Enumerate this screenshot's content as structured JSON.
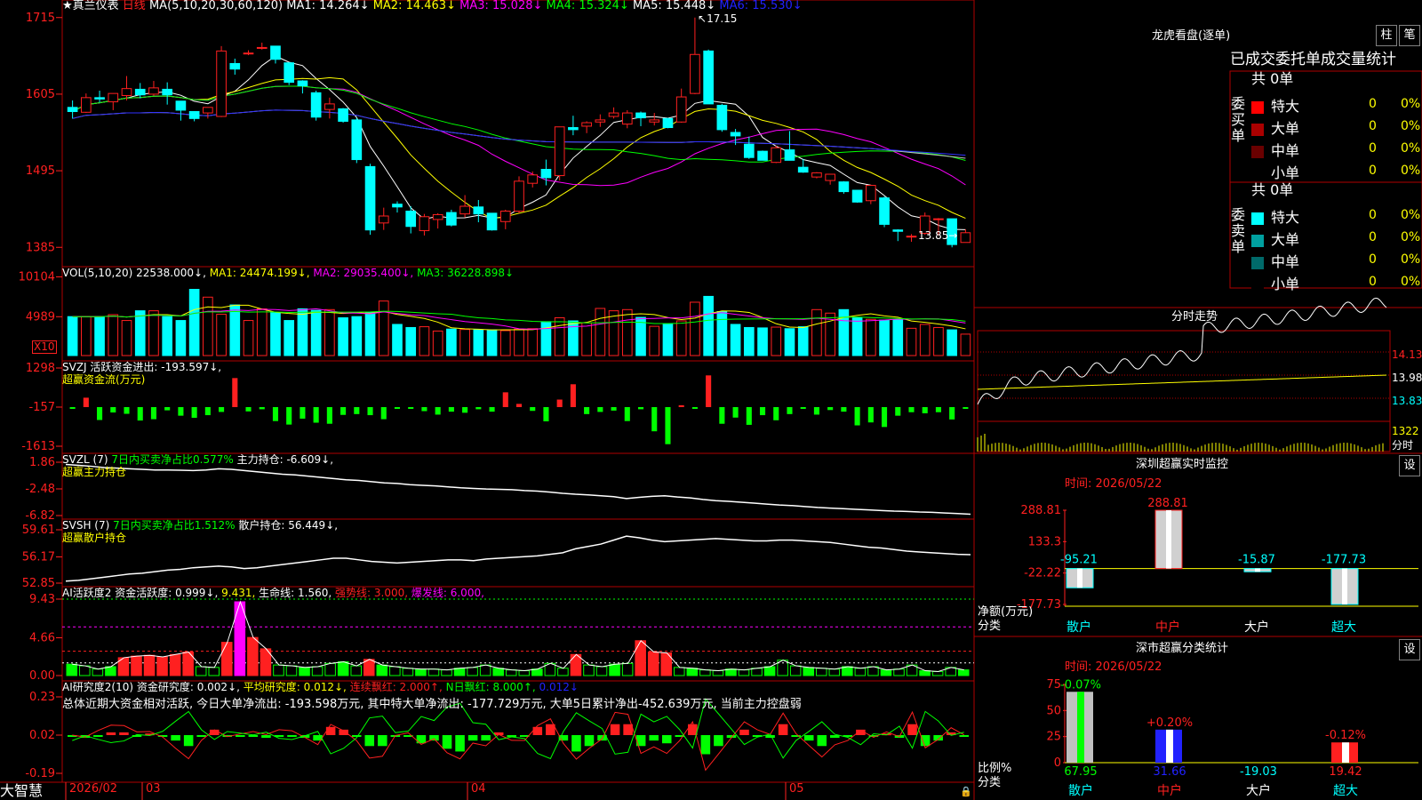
{
  "stock": {
    "title": "★真兰仪表",
    "period": "日线",
    "ma_title": "MA(5,10,20,30,60,120)",
    "ma_values": [
      "MA1: 14.264↓",
      "MA2: 14.463↓",
      "MA3: 15.028↓",
      "MA4: 15.324↓",
      "MA5: 15.448↓",
      "MA6: 15.530↓"
    ],
    "ma_colors": [
      "#ffffff",
      "#ffff00",
      "#ff00ff",
      "#00ff00",
      "#c0c0c0",
      "#3030ff"
    ],
    "max_label": "17.15",
    "min_label": "13.85",
    "y_ticks": [
      "1715",
      "1605",
      "1495",
      "1385"
    ],
    "x_labels": [
      "2026/02",
      "03",
      "04",
      "05"
    ],
    "x_marks": [
      "2026/02",
      "03",
      "04",
      "05"
    ]
  },
  "candles": {
    "type": "candlestick",
    "ylim": [
      13.7,
      17.3
    ],
    "data": [
      [
        15.86,
        15.96,
        15.7,
        15.8
      ],
      [
        15.79,
        16.06,
        15.78,
        16.0
      ],
      [
        16.0,
        16.1,
        15.93,
        15.98
      ],
      [
        15.94,
        16.04,
        15.82,
        16.06
      ],
      [
        16.03,
        16.31,
        15.96,
        16.13
      ],
      [
        16.12,
        16.21,
        15.99,
        16.04
      ],
      [
        16.05,
        16.24,
        16.03,
        16.14
      ],
      [
        16.12,
        16.22,
        15.9,
        16.04
      ],
      [
        15.95,
        15.95,
        15.67,
        15.82
      ],
      [
        15.8,
        15.8,
        15.66,
        15.7
      ],
      [
        15.78,
        15.85,
        15.7,
        15.86
      ],
      [
        15.73,
        16.74,
        15.72,
        16.67
      ],
      [
        16.49,
        16.56,
        16.33,
        16.41
      ],
      [
        16.64,
        16.68,
        16.61,
        16.64
      ],
      [
        16.71,
        16.79,
        16.69,
        16.72
      ],
      [
        16.74,
        16.74,
        16.49,
        16.55
      ],
      [
        16.5,
        16.5,
        16.18,
        16.22
      ],
      [
        16.24,
        16.25,
        16.06,
        16.17
      ],
      [
        16.07,
        16.1,
        15.67,
        15.72
      ],
      [
        15.83,
        16.0,
        15.7,
        15.91
      ],
      [
        15.84,
        15.85,
        15.64,
        15.66
      ],
      [
        15.68,
        15.71,
        15.06,
        15.11
      ],
      [
        15.01,
        15.05,
        14.03,
        14.1
      ],
      [
        14.2,
        14.42,
        14.1,
        14.3
      ],
      [
        14.47,
        14.51,
        14.35,
        14.43
      ],
      [
        14.37,
        14.44,
        14.05,
        14.15
      ],
      [
        14.09,
        14.33,
        14.02,
        14.29
      ],
      [
        14.25,
        14.34,
        14.12,
        14.32
      ],
      [
        14.35,
        14.39,
        14.15,
        14.17
      ],
      [
        14.33,
        14.6,
        14.28,
        14.44
      ],
      [
        14.43,
        14.53,
        14.21,
        14.33
      ],
      [
        14.34,
        14.34,
        14.09,
        14.1
      ],
      [
        14.22,
        14.39,
        14.11,
        14.37
      ],
      [
        14.37,
        14.87,
        14.34,
        14.8
      ],
      [
        14.77,
        14.94,
        14.71,
        14.89
      ],
      [
        14.97,
        15.11,
        14.74,
        14.85
      ],
      [
        14.88,
        15.58,
        14.81,
        15.58
      ],
      [
        15.57,
        15.74,
        15.46,
        15.54
      ],
      [
        15.59,
        15.66,
        15.49,
        15.64
      ],
      [
        15.65,
        15.76,
        15.58,
        15.68
      ],
      [
        15.73,
        15.86,
        15.7,
        15.78
      ],
      [
        15.62,
        15.82,
        15.56,
        15.78
      ],
      [
        15.78,
        15.8,
        15.59,
        15.71
      ],
      [
        15.65,
        15.78,
        15.6,
        15.68
      ],
      [
        15.7,
        15.71,
        15.56,
        15.57
      ],
      [
        15.65,
        16.13,
        15.64,
        16.01
      ],
      [
        16.06,
        17.15,
        16.05,
        16.62
      ],
      [
        16.67,
        16.69,
        15.92,
        15.91
      ],
      [
        15.89,
        15.91,
        15.51,
        15.54
      ],
      [
        15.5,
        15.55,
        15.32,
        15.45
      ],
      [
        15.33,
        15.44,
        15.12,
        15.14
      ],
      [
        15.23,
        15.24,
        15.1,
        15.1
      ],
      [
        15.07,
        15.31,
        15.06,
        15.28
      ],
      [
        15.25,
        15.52,
        15.15,
        15.1
      ],
      [
        15.0,
        15.12,
        14.92,
        14.93
      ],
      [
        14.86,
        14.93,
        14.84,
        14.92
      ],
      [
        14.81,
        14.89,
        14.75,
        14.9
      ],
      [
        14.79,
        14.8,
        14.62,
        14.65
      ],
      [
        14.67,
        14.67,
        14.49,
        14.5
      ],
      [
        14.52,
        14.75,
        14.47,
        14.74
      ],
      [
        14.56,
        14.58,
        14.14,
        14.18
      ],
      [
        14.1,
        14.11,
        13.94,
        14.08
      ],
      [
        14.0,
        14.04,
        13.93,
        14.01
      ],
      [
        14.05,
        14.35,
        14.03,
        14.3
      ],
      [
        14.25,
        14.27,
        14.02,
        14.26
      ],
      [
        14.26,
        14.26,
        13.85,
        13.89
      ],
      [
        13.92,
        14.11,
        13.92,
        14.06
      ]
    ]
  },
  "volume": {
    "title": "VOL(5,10,20)",
    "val_main": "22538.000↓",
    "ma1": "MA1: 24474.199↓",
    "ma2": "MA2: 29035.400↓",
    "ma3": "MA3: 36228.898↓",
    "y_ticks": [
      "10104",
      "4989"
    ],
    "unit_box": "X10",
    "values": [
      10000,
      10000,
      10000,
      10500,
      9000,
      11500,
      11500,
      10000,
      9000,
      17000,
      15000,
      10600,
      13000,
      9000,
      12000,
      11000,
      9000,
      12000,
      11600,
      11800,
      9700,
      10000,
      11100,
      14000,
      8000,
      7200,
      7400,
      6300,
      6800,
      6700,
      6600,
      6600,
      6400,
      6800,
      6900,
      8700,
      9700,
      8900,
      8400,
      12100,
      11500,
      11800,
      9800,
      7500,
      8200,
      8900,
      13700,
      15200,
      11300,
      8000,
      7200,
      7100,
      7300,
      6900,
      7400,
      11800,
      10900,
      11800,
      9800,
      9300,
      9100,
      9200,
      7000,
      8000,
      7200,
      6600,
      5500
    ],
    "ylim": [
      0,
      21000
    ]
  },
  "svzj": {
    "title": "SVZJ",
    "label": "活跃资金进出: -193.597↓,",
    "sub": "超赢资金流(万元)",
    "y_ticks": [
      "1298",
      "-157",
      "-1613"
    ],
    "ylim": [
      -1613,
      1298
    ],
    "values": [
      -30,
      350,
      -480,
      -200,
      -250,
      -500,
      -450,
      -120,
      -320,
      -400,
      -300,
      -180,
      1080,
      -160,
      -80,
      -520,
      -650,
      -430,
      -580,
      -620,
      -290,
      -260,
      -300,
      -450,
      -60,
      -40,
      -150,
      -280,
      -170,
      -210,
      -80,
      -170,
      550,
      120,
      -140,
      -530,
      280,
      850,
      -260,
      -180,
      -130,
      -520,
      -80,
      -900,
      -1380,
      70,
      -60,
      1180,
      -620,
      -390,
      -660,
      -300,
      -490,
      -260,
      -60,
      -280,
      -110,
      -170,
      -680,
      -570,
      -740,
      -320,
      -190,
      -230,
      -190,
      -460,
      -50,
      350,
      -400,
      -150,
      -100,
      -80
    ]
  },
  "svzl": {
    "title": "SVZL (7)",
    "label1": "7日内买卖净占比0.577%",
    "label2": "主力持仓: -6.609↓,",
    "sub": "超赢主力持仓",
    "y_ticks": [
      "1.86",
      "-2.48",
      "-6.82"
    ],
    "ylim": [
      -6.82,
      1.86
    ],
    "values": [
      1.5,
      1.35,
      1.2,
      1.0,
      0.9,
      0.8,
      0.7,
      0.6,
      0.6,
      0.55,
      0.5,
      0.6,
      0.8,
      0.7,
      0.5,
      0.3,
      0.1,
      -0.1,
      -0.2,
      -0.4,
      -0.6,
      -0.8,
      -1.0,
      -1.1,
      -1.3,
      -1.5,
      -1.6,
      -1.8,
      -1.9,
      -2.0,
      -2.15,
      -2.3,
      -2.4,
      -2.5,
      -2.55,
      -2.6,
      -2.75,
      -2.85,
      -3.0,
      -3.2,
      -3.35,
      -3.45,
      -3.6,
      -3.75,
      -4.05,
      -3.85,
      -3.7,
      -3.6,
      -3.8,
      -3.95,
      -4.2,
      -4.4,
      -4.5,
      -4.65,
      -4.8,
      -4.95,
      -5.1,
      -5.2,
      -5.35,
      -5.5,
      -5.6,
      -5.7,
      -5.8,
      -5.9,
      -6.0,
      -6.1,
      -6.15,
      -6.25,
      -6.3,
      -6.4,
      -6.5,
      -6.61
    ]
  },
  "svsh": {
    "title": "SVSH (7)",
    "label1": "7日内买卖净占比1.512%",
    "label2": "散户持仓: 56.449↓,",
    "sub": "超赢散户持仓",
    "y_ticks": [
      "59.61",
      "56.17",
      "52.85"
    ],
    "ylim": [
      52.85,
      59.61
    ],
    "values": [
      53.1,
      53.2,
      53.4,
      53.6,
      53.8,
      54.0,
      54.1,
      54.3,
      54.5,
      54.6,
      54.8,
      54.9,
      55.0,
      54.9,
      54.7,
      54.8,
      55.0,
      55.2,
      55.4,
      55.6,
      55.8,
      56.0,
      56.0,
      55.8,
      55.6,
      55.5,
      55.4,
      55.5,
      55.6,
      55.7,
      55.8,
      55.8,
      55.7,
      55.9,
      56.0,
      56.1,
      56.2,
      56.3,
      56.5,
      56.7,
      57.2,
      57.5,
      57.8,
      58.3,
      58.8,
      58.6,
      58.3,
      58.1,
      58.2,
      58.3,
      58.4,
      58.5,
      58.4,
      58.3,
      58.2,
      58.2,
      58.3,
      58.3,
      58.2,
      58.1,
      58.0,
      57.8,
      57.6,
      57.4,
      57.3,
      57.1,
      56.9,
      56.8,
      56.7,
      56.6,
      56.5,
      56.45
    ]
  },
  "ai1": {
    "title": "AI活跃度2",
    "label1": "资金活跃度: 0.999↓",
    "label2": "9.431,",
    "label3": "生命线: 1.560,",
    "label4": "强势线: 3.000,",
    "label5": "爆发线: 6.000,",
    "y_ticks": [
      "9.43",
      "4.66",
      "0.00"
    ],
    "ylim": [
      0,
      9.43
    ],
    "values": [
      1.4,
      1.2,
      0.8,
      1.1,
      2.2,
      2.4,
      2.5,
      2.3,
      2.6,
      2.9,
      1.1,
      1.0,
      4.1,
      9.1,
      4.7,
      3.3,
      1.3,
      1.2,
      1.0,
      1.1,
      1.5,
      1.7,
      1.2,
      2.0,
      1.3,
      1.1,
      0.9,
      0.8,
      0.8,
      0.7,
      0.9,
      1.0,
      1.3,
      0.9,
      0.7,
      0.6,
      0.8,
      1.5,
      0.9,
      2.6,
      1.3,
      1.1,
      1.4,
      1.5,
      4.3,
      2.9,
      2.8,
      1.0,
      0.9,
      0.7,
      0.6,
      0.8,
      0.7,
      0.9,
      1.1,
      1.9,
      1.2,
      1.0,
      0.9,
      0.8,
      1.1,
      0.9,
      1.1,
      0.7,
      0.8,
      1.3,
      0.6,
      0.5,
      1.0,
      0.7
    ]
  },
  "ai2": {
    "title": "AI研究度2(10)",
    "label1": "资金研究度: 0.002↓,",
    "label2": "平均研究度: 0.012↓,",
    "label3": "连续飘红: 2.000↑,",
    "label4": "N日飘红: 8.000↑,",
    "label5": "0.012↓",
    "summary": "总体近期大资金相对活跃, 今日大单净流出: -193.598万元, 其中特大单净流出: -177.729万元, 大单5日累计净出-452.639万元, 当前主力控盘弱",
    "y_ticks": [
      "0.23",
      "0.02",
      "-0.19"
    ],
    "ylim": [
      -0.19,
      0.23
    ],
    "values": [
      0.0,
      -0.005,
      0.0,
      0.005,
      0.005,
      0.0,
      0.003,
      0.0,
      -0.01,
      -0.02,
      0.0,
      0.01,
      0.0,
      0.0,
      0.0,
      -0.005,
      0.0,
      0.0,
      -0.005,
      -0.01,
      0.015,
      0.01,
      0.0,
      -0.02,
      -0.02,
      0.0,
      0.0,
      -0.015,
      -0.01,
      -0.025,
      -0.03,
      -0.01,
      -0.01,
      0.005,
      0.0,
      0.0,
      0.015,
      0.02,
      -0.01,
      -0.03,
      -0.02,
      -0.01,
      0.02,
      0.02,
      -0.02,
      -0.01,
      -0.015,
      0.0,
      0.02,
      -0.035,
      -0.02,
      -0.005,
      0.01,
      0.0,
      -0.005,
      0.02,
      0.0,
      -0.01,
      -0.02,
      -0.005,
      0.0,
      0.01,
      0.0,
      0.003,
      -0.005,
      0.02,
      -0.02,
      -0.01,
      0.005,
      0.0
    ]
  },
  "bottom": {
    "brand": "大智慧",
    "lock_icon": "lock-icon"
  },
  "right": {
    "lhb_title": "龙虎看盘(逐单)",
    "btn1": "柱",
    "btn2": "笔",
    "tabs": [
      "已成交",
      "委托单",
      "成交量统计"
    ],
    "buy": {
      "side": "委买单",
      "total": "共 0单",
      "rows": [
        {
          "label": "特大",
          "count": "0",
          "pct": "0%",
          "color": "#ff0000"
        },
        {
          "label": "大单",
          "count": "0",
          "pct": "0%",
          "color": "#aa0000"
        },
        {
          "label": "中单",
          "count": "0",
          "pct": "0%",
          "color": "#6a0000"
        },
        {
          "label": "小单",
          "count": "0",
          "pct": "0%",
          "color": "#000000"
        }
      ]
    },
    "sell": {
      "side": "委卖单",
      "total": "共 0单",
      "rows": [
        {
          "label": "特大",
          "count": "0",
          "pct": "0%",
          "color": "#00ffff"
        },
        {
          "label": "大单",
          "count": "0",
          "pct": "0%",
          "color": "#00a0a0"
        },
        {
          "label": "中单",
          "count": "0",
          "pct": "0%",
          "color": "#006a6a"
        },
        {
          "label": "小单",
          "count": "0",
          "pct": "0%",
          "color": "#000000"
        }
      ]
    },
    "fs_title": "分时走势",
    "fs_prices": [
      "14.13",
      "13.98",
      "13.83"
    ],
    "fs_vol": "1322",
    "fs_unit": "分时",
    "sz_title": "深圳超赢实时监控",
    "sz_btn": "设",
    "sz_time": "时间: 2026/05/22",
    "sz_y_ticks": [
      "288.81",
      "133.3",
      "-22.22",
      "-177.73"
    ],
    "sz_axis_label": "净额(万元)",
    "sz_axis_label2": "分类",
    "sz_categories": [
      "散户",
      "中户",
      "大户",
      "超大"
    ],
    "sz_values": [
      -95.21,
      288.81,
      -15.87,
      -177.73
    ],
    "sz_value_labels": [
      "-95.21",
      "288.81",
      "-15.87",
      "-177.73"
    ],
    "sc_title": "深市超赢分类统计",
    "sc_btn": "设",
    "sc_time": "时间: 2026/05/22",
    "sc_y_ticks": [
      "75",
      "50",
      "25",
      "0"
    ],
    "sc_axis_label": "比例%",
    "sc_axis_label2": "分类",
    "sc_categories": [
      "散户",
      "中户",
      "大户",
      "超大"
    ],
    "sc_values": [
      67.95,
      31.66,
      -19.03,
      19.42
    ],
    "sc_value_labels": [
      "67.95",
      "31.66",
      "-19.03",
      "19.42"
    ],
    "sc_change_labels": [
      "-0.07%",
      "+0.20%",
      "",
      "-0.12%"
    ]
  },
  "colors": {
    "up": "#ff2020",
    "down": "#00ffff",
    "border": "#b00000",
    "green": "#00ff00"
  }
}
